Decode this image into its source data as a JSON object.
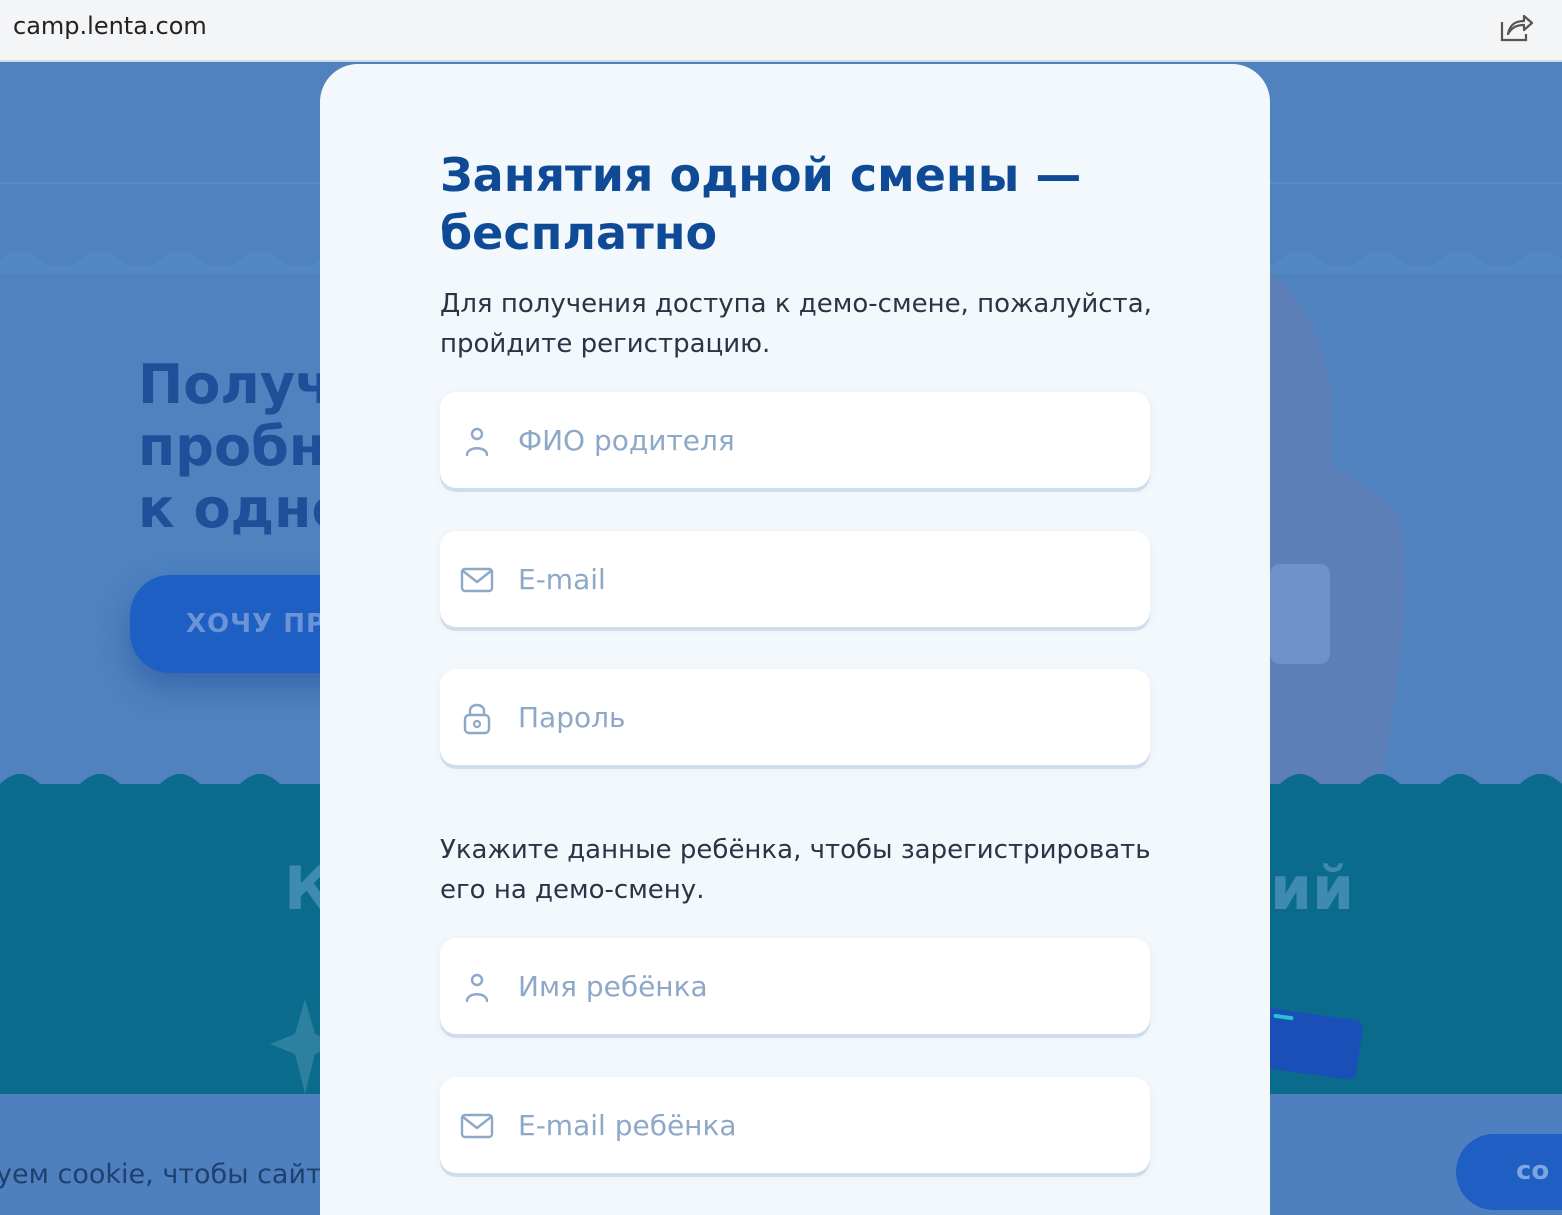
{
  "browser": {
    "url": "camp.lenta.com",
    "share_icon": "share-icon"
  },
  "background": {
    "hero_title": "Получи\nпробны\nк одно",
    "hero_button": "ХОЧУ ПР",
    "teal_heading_left": "К",
    "teal_heading_right": "ий",
    "cookie_text": "уем cookie, чтобы сайт б",
    "cookie_button": "со",
    "colors": {
      "page_blue": "#4f82bf",
      "teal": "#0b6b8c",
      "accent_blue": "#1e5fc4"
    }
  },
  "modal": {
    "title": "Занятия одной смены — бесплатно",
    "subtitle": "Для получения доступа к демо-смене, пожалуйста, пройдите регистрацию.",
    "parent_fields": [
      {
        "icon": "user-icon",
        "placeholder": "ФИО родителя",
        "value": ""
      },
      {
        "icon": "mail-icon",
        "placeholder": "E-mail",
        "value": ""
      },
      {
        "icon": "lock-icon",
        "placeholder": "Пароль",
        "value": ""
      }
    ],
    "child_section_text": "Укажите данные ребёнка, чтобы зарегистрировать его на демо-смену.",
    "child_fields": [
      {
        "icon": "user-icon",
        "placeholder": "Имя ребёнка",
        "value": ""
      },
      {
        "icon": "mail-icon",
        "placeholder": "E-mail ребёнка",
        "value": ""
      }
    ],
    "colors": {
      "title": "#0f4a96",
      "placeholder": "#8ea8c8",
      "background": "#f3f8fc"
    }
  }
}
